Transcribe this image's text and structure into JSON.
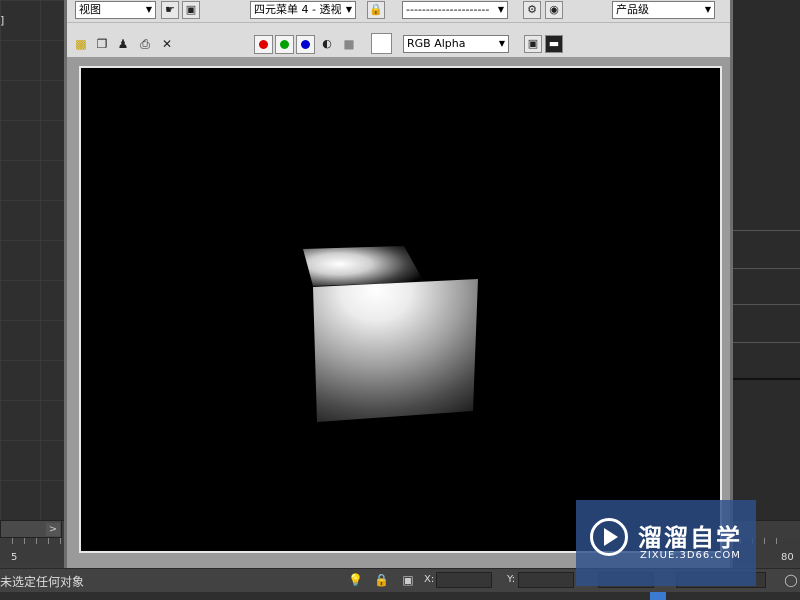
{
  "render_window": {
    "toolbar": {
      "area_dropdown": "视图",
      "viewport_dropdown": "四元菜单 4 - 透视",
      "preset_dropdown": "---------------------",
      "quality_dropdown": "产品级",
      "channel_dropdown": "RGB Alpha"
    }
  },
  "background": {
    "corner_glyph": "]",
    "slider_arrow": ">",
    "ruler_numbers": [
      "5",
      "80"
    ]
  },
  "statusbar": {
    "message": "未选定任何对象",
    "x_label": "X:",
    "y_label": "Y:"
  },
  "watermark": {
    "title": "溜溜自学",
    "url": "ZIXUE.3D66.COM"
  },
  "colors": {
    "red_channel": "#e00000",
    "green_channel": "#00a000",
    "blue_channel": "#0000d0",
    "watermark_bg": "#2d508c"
  }
}
